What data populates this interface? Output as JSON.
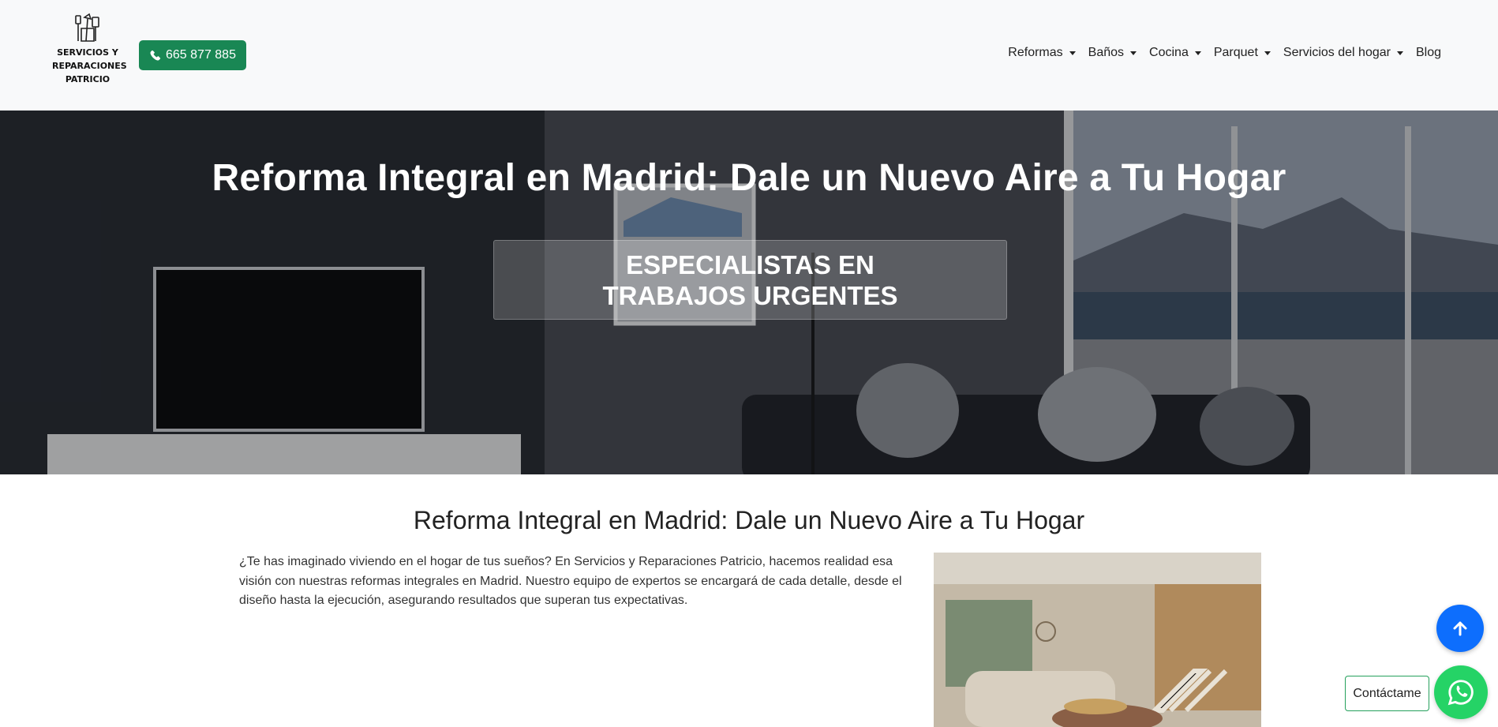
{
  "brand": {
    "logo_text": "SERVICIOS Y\nREPARACIONES\nPATRICIO",
    "phone_label": "665 877 885"
  },
  "nav": {
    "items": [
      {
        "label": "Reformas",
        "dropdown": true
      },
      {
        "label": "Baños",
        "dropdown": true
      },
      {
        "label": "Cocina",
        "dropdown": true
      },
      {
        "label": "Parquet",
        "dropdown": true
      },
      {
        "label": "Servicios del hogar",
        "dropdown": true
      },
      {
        "label": "Blog",
        "dropdown": false
      }
    ]
  },
  "hero": {
    "title": "Reforma Integral en Madrid: Dale un Nuevo Aire a Tu Hogar",
    "badge": "ESPECIALISTAS EN TRABAJOS URGENTES"
  },
  "content": {
    "title": "Reforma Integral en Madrid: Dale un Nuevo Aire a Tu Hogar",
    "intro": "¿Te has imaginado viviendo en el hogar de tus sueños? En Servicios y Reparaciones Patricio, hacemos realidad esa visión con nuestras reformas integrales en Madrid. Nuestro equipo de expertos se encargará de cada detalle, desde el diseño hasta la ejecución, asegurando resultados que superan tus expectativas."
  },
  "floating": {
    "contact_label": "Contáctame"
  },
  "colors": {
    "phone_button": "#198754",
    "scroll_top": "#0d6efd",
    "whatsapp": "#25d366"
  },
  "icons": {
    "phone": "phone-icon",
    "scroll_top": "arrow-up-icon",
    "whatsapp": "whatsapp-icon",
    "logo": "tools-icon"
  }
}
